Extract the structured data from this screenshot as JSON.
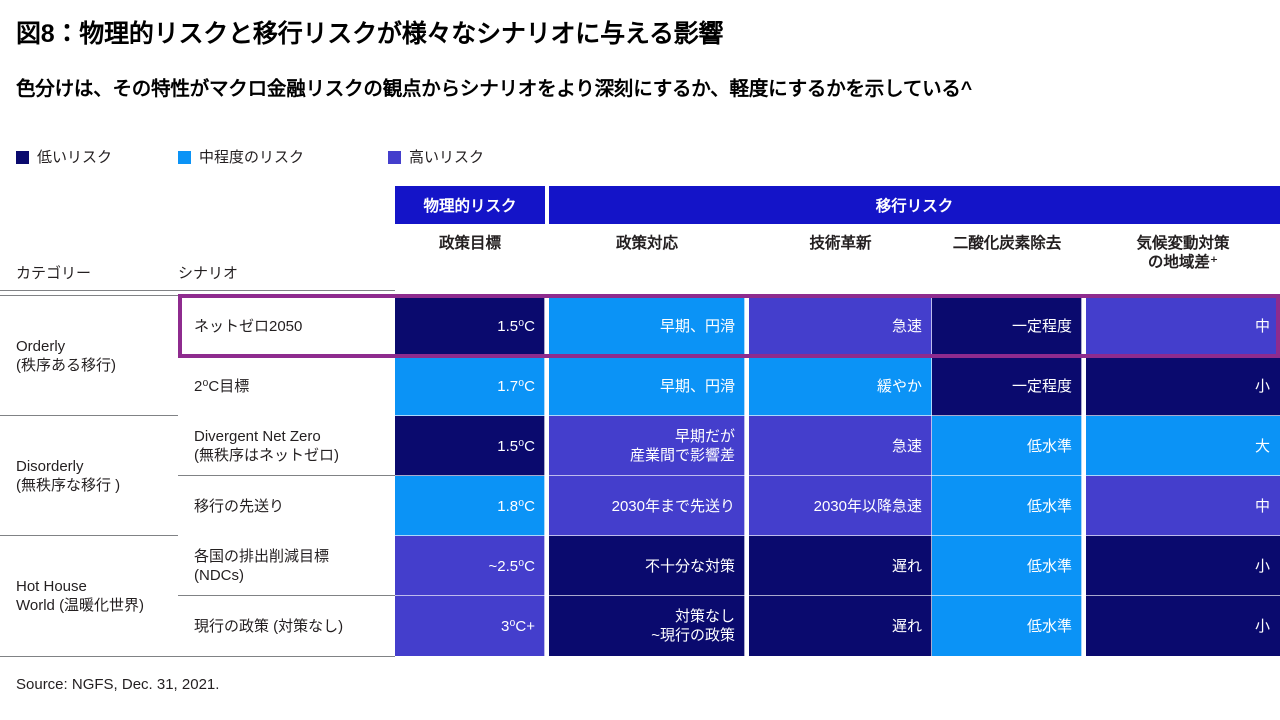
{
  "title": "図8：物理的リスクと移行リスクが様々なシナリオに与える影響",
  "subtitle": "色分けは、その特性がマクロ金融リスクの観点からシナリオをより深刻にするか、軽度にするかを示している^",
  "source": "Source: NGFS, Dec. 31, 2021.",
  "colors": {
    "low": "#0a0a6e",
    "medium": "#0b93f6",
    "high": "#443ecc",
    "header_band": "#1414c8",
    "highlight_border": "#8e2b8e",
    "text_dark": "#231f20",
    "white": "#ffffff"
  },
  "legend": {
    "items": [
      {
        "label": "低いリスク",
        "color": "#0a0a6e",
        "key": "low"
      },
      {
        "label": "中程度のリスク",
        "color": "#0b93f6",
        "key": "medium"
      },
      {
        "label": "高いリスク",
        "color": "#443ecc",
        "key": "high"
      }
    ]
  },
  "table": {
    "group_headers": [
      {
        "label": "物理的リスク"
      },
      {
        "label": "移行リスク"
      }
    ],
    "row_headers": [
      {
        "label": "カテゴリー"
      },
      {
        "label": "シナリオ"
      }
    ],
    "column_headers": [
      {
        "label": "政策目標"
      },
      {
        "label": "政策対応"
      },
      {
        "label": "技術革新"
      },
      {
        "label": "二酸化炭素除去"
      },
      {
        "label": "気候変動対策",
        "label2": "の地域差⁺"
      }
    ],
    "categories": [
      {
        "line1": "Orderly",
        "line2": "(秩序ある移行)"
      },
      {
        "line1": "Disorderly",
        "line2": "(無秩序な移行 )"
      },
      {
        "line1": "Hot House",
        "line2": "World (温暖化世界)"
      }
    ],
    "rows": [
      {
        "scenario_line1": "ネットゼロ2050",
        "scenario_line2": "",
        "highlighted": true,
        "cells": [
          {
            "text": "1.5⁰C",
            "level": "low"
          },
          {
            "text": "早期、円滑",
            "text2": "",
            "level": "medium"
          },
          {
            "text": "急速",
            "level": "high"
          },
          {
            "text": "一定程度",
            "level": "low"
          },
          {
            "text": "中",
            "level": "high"
          }
        ]
      },
      {
        "scenario_line1": "2⁰C目標",
        "scenario_line2": "",
        "highlighted": false,
        "cells": [
          {
            "text": "1.7⁰C",
            "level": "medium"
          },
          {
            "text": "早期、円滑",
            "text2": "",
            "level": "medium"
          },
          {
            "text": "緩やか",
            "level": "medium"
          },
          {
            "text": "一定程度",
            "level": "low"
          },
          {
            "text": "小",
            "level": "low"
          }
        ]
      },
      {
        "scenario_line1": "Divergent Net Zero",
        "scenario_line2": "(無秩序はネットゼロ)",
        "highlighted": false,
        "cells": [
          {
            "text": "1.5⁰C",
            "level": "low"
          },
          {
            "text": "早期だが",
            "text2": "産業間で影響差",
            "level": "high"
          },
          {
            "text": "急速",
            "level": "high"
          },
          {
            "text": "低水準",
            "level": "medium"
          },
          {
            "text": "大",
            "level": "medium"
          }
        ]
      },
      {
        "scenario_line1": "移行の先送り",
        "scenario_line2": "",
        "highlighted": false,
        "cells": [
          {
            "text": "1.8⁰C",
            "level": "medium"
          },
          {
            "text": "2030年まで先送り",
            "text2": "",
            "level": "high"
          },
          {
            "text": "2030年以降急速",
            "level": "high"
          },
          {
            "text": "低水準",
            "level": "medium"
          },
          {
            "text": "中",
            "level": "high"
          }
        ]
      },
      {
        "scenario_line1": "各国の排出削減目標",
        "scenario_line2": "(NDCs)",
        "highlighted": false,
        "cells": [
          {
            "text": "~2.5⁰C",
            "level": "high"
          },
          {
            "text": "不十分な対策",
            "text2": "",
            "level": "low"
          },
          {
            "text": "遅れ",
            "level": "low"
          },
          {
            "text": "低水準",
            "level": "medium"
          },
          {
            "text": "小",
            "level": "low"
          }
        ]
      },
      {
        "scenario_line1": "現行の政策 (対策なし)",
        "scenario_line2": "",
        "highlighted": false,
        "cells": [
          {
            "text": "3⁰C+",
            "level": "high"
          },
          {
            "text": "対策なし",
            "text2": "~現行の政策",
            "level": "low"
          },
          {
            "text": "遅れ",
            "level": "low"
          },
          {
            "text": "低水準",
            "level": "medium"
          },
          {
            "text": "小",
            "level": "low"
          }
        ]
      }
    ]
  }
}
